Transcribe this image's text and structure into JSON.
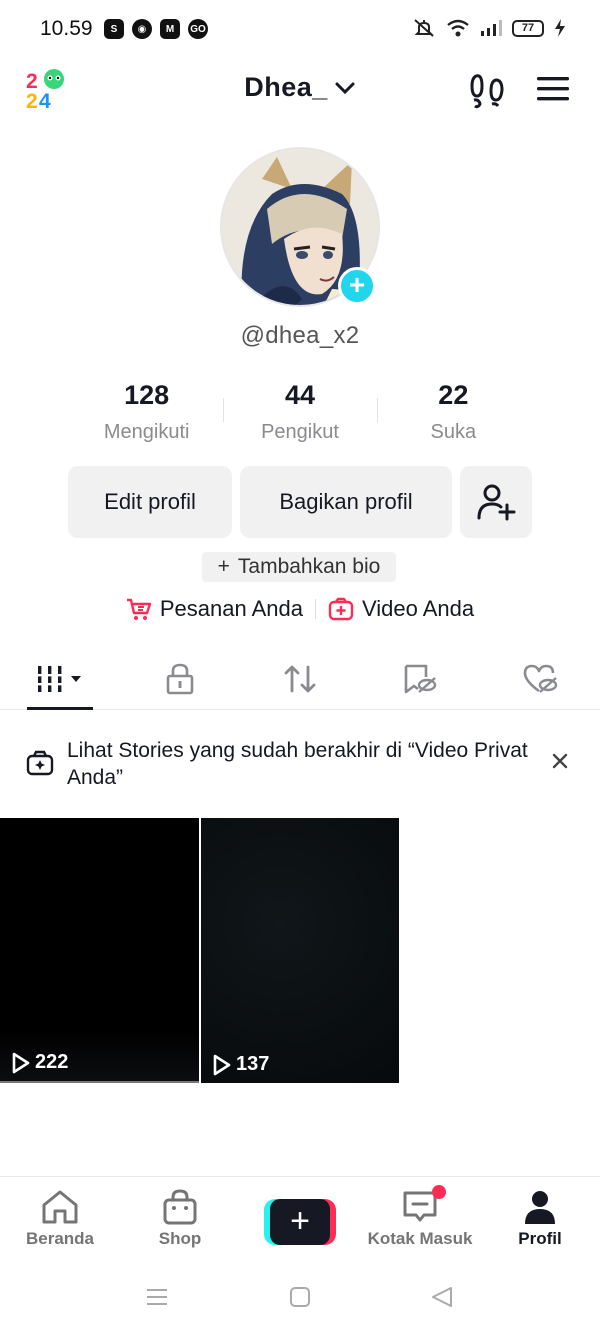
{
  "status_bar": {
    "time": "10.59",
    "app_icons": [
      "S",
      "◉",
      "M",
      "GO"
    ],
    "battery": "77"
  },
  "header": {
    "username": "Dhea_",
    "logo_icon": "2024-logo-icon",
    "footprints_icon": "footprints-icon",
    "menu_icon": "hamburger-menu-icon"
  },
  "profile": {
    "handle": "@dhea_x2",
    "add_icon": "+"
  },
  "stats": [
    {
      "value": "128",
      "label": "Mengikuti"
    },
    {
      "value": "44",
      "label": "Pengikut"
    },
    {
      "value": "22",
      "label": "Suka"
    }
  ],
  "buttons": {
    "edit_profile": "Edit profil",
    "share_profile": "Bagikan profil",
    "add_bio_plus": "+",
    "add_bio": "Tambahkan bio"
  },
  "links": {
    "orders": "Pesanan Anda",
    "videos": "Video Anda"
  },
  "banner": {
    "text": "Lihat Stories yang sudah berakhir di “Video Privat Anda”"
  },
  "videos": [
    {
      "views": "222"
    },
    {
      "views": "137"
    }
  ],
  "bottom_nav": [
    {
      "label": "Beranda"
    },
    {
      "label": "Shop"
    },
    {
      "label": ""
    },
    {
      "label": "Kotak Masuk"
    },
    {
      "label": "Profil"
    }
  ],
  "colors": {
    "accent_cyan": "#25f4ee",
    "accent_red": "#fe2c55",
    "text_primary": "#161823",
    "text_secondary": "#8a8b91"
  }
}
